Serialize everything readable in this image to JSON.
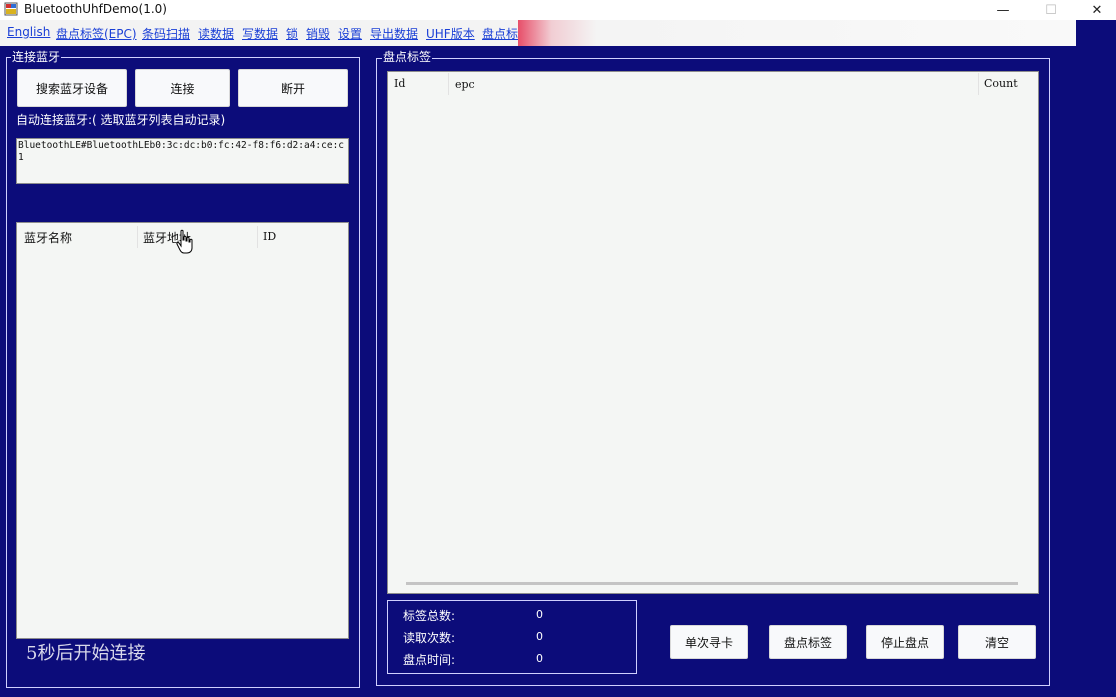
{
  "window": {
    "title": "BluetoothUhfDemo(1.0)",
    "minimize_glyph": "—",
    "maximize_glyph": "☐",
    "close_glyph": "✕"
  },
  "menu": [
    {
      "label": "English"
    },
    {
      "label": "盘点标签(EPC)"
    },
    {
      "label": "条码扫描"
    },
    {
      "label": "读数据"
    },
    {
      "label": "写数据"
    },
    {
      "label": "锁"
    },
    {
      "label": "销毁"
    },
    {
      "label": "设置"
    },
    {
      "label": "导出数据"
    },
    {
      "label": "UHF版本"
    },
    {
      "label": "盘点标"
    }
  ],
  "bluetooth": {
    "group_title": "连接蓝牙",
    "search_button": "搜索蓝牙设备",
    "connect_button": "连接",
    "disconnect_button": "断开",
    "auto_connect_label": "自动连接蓝牙:( 选取蓝牙列表自动记录)",
    "saved_address": "BluetoothLE#BluetoothLEb0:3c:dc:b0:fc:42-f8:f6:d2:a4:ce:c1",
    "table_headers": {
      "name": "蓝牙名称",
      "address": "蓝牙地址",
      "id": "ID"
    },
    "countdown_text": "5秒后开始连接"
  },
  "inventory": {
    "group_title": "盘点标签",
    "table_headers": {
      "id": "Id",
      "epc": "epc",
      "count": "Count"
    },
    "stats": {
      "total_label": "标签总数:",
      "total_value": "0",
      "reads_label": "读取次数:",
      "reads_value": "0",
      "time_label": "盘点时间:",
      "time_value": "0"
    },
    "buttons": {
      "single": "单次寻卡",
      "inventory": "盘点标签",
      "stop": "停止盘点",
      "clear": "清空"
    }
  },
  "colors": {
    "background": "#0c0c7a",
    "menu_link": "#1a3fd6",
    "panel": "#f4f6f4"
  }
}
